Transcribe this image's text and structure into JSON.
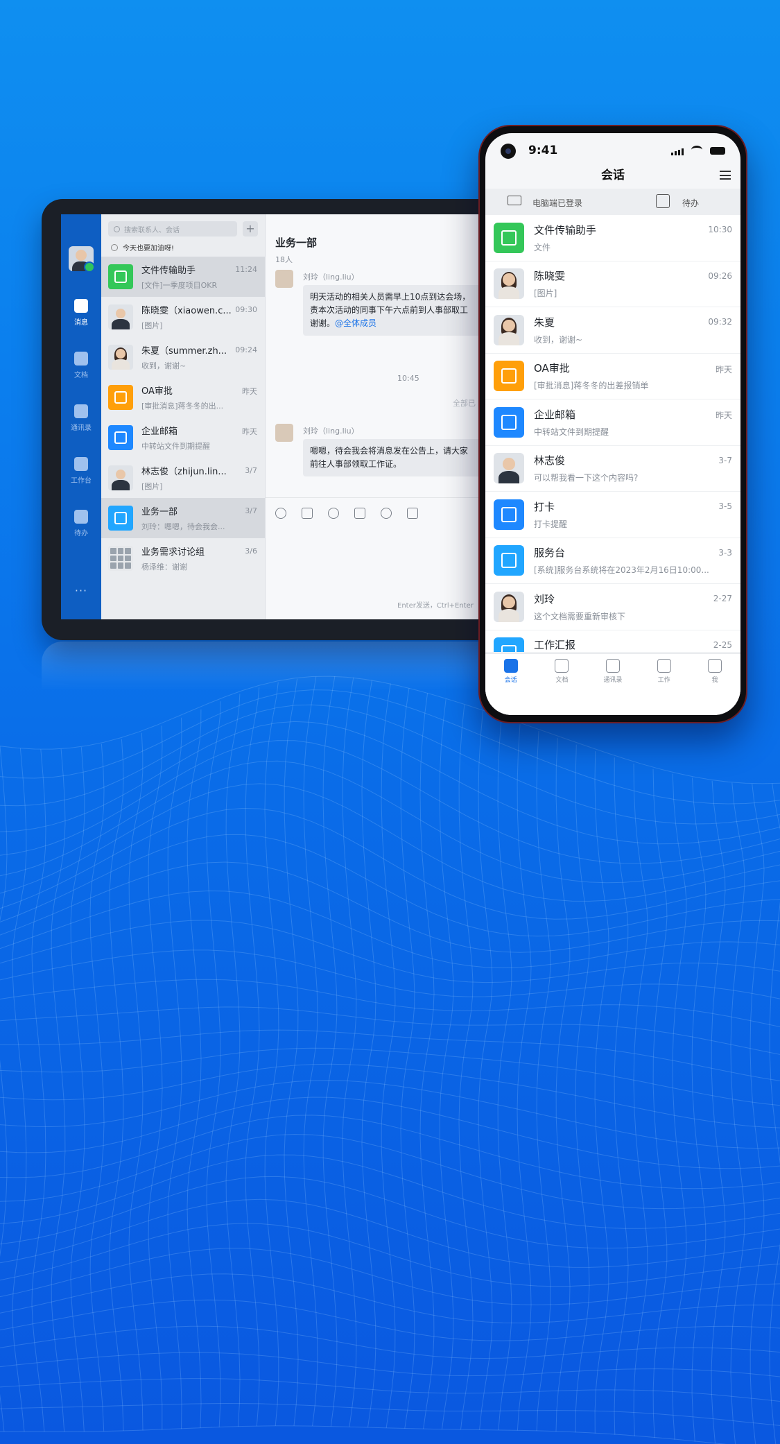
{
  "tablet": {
    "search_placeholder": "搜索联系人、会话",
    "add_label": "+",
    "motto": "今天也要加油呀!",
    "rail": [
      {
        "label": "消息",
        "icon": "message-icon",
        "active": true
      },
      {
        "label": "文档",
        "icon": "document-icon",
        "active": false
      },
      {
        "label": "通讯录",
        "icon": "contacts-icon",
        "active": false
      },
      {
        "label": "工作台",
        "icon": "workbench-icon",
        "active": false
      },
      {
        "label": "待办",
        "icon": "todo-icon",
        "active": false
      }
    ],
    "more_label": "···",
    "conversations": [
      {
        "name": "文件传输助手",
        "preview": "[文件]一季度项目OKR",
        "time": "11:24",
        "avatar": "green",
        "selected": true
      },
      {
        "name": "陈晓雯（xiaowen.c...",
        "preview": "[图片]",
        "time": "09:30",
        "avatar": "photo-m"
      },
      {
        "name": "朱夏（summer.zh...",
        "preview": "收到，谢谢~",
        "time": "09:24",
        "avatar": "photo-f"
      },
      {
        "name": "OA审批",
        "preview": "[审批消息]蒋冬冬的出...",
        "time": "昨天",
        "avatar": "orange"
      },
      {
        "name": "企业邮箱",
        "preview": "中转站文件到期提醒",
        "time": "昨天",
        "avatar": "blue"
      },
      {
        "name": "林志俊（zhijun.lin...",
        "preview": "[图片]",
        "time": "3/7",
        "avatar": "photo-m"
      },
      {
        "name": "业务一部",
        "preview": "刘玲：嗯嗯，待会我会...",
        "time": "3/7",
        "avatar": "cyan",
        "selected": true
      },
      {
        "name": "业务需求讨论组",
        "preview": "杨泽维：谢谢",
        "time": "3/6",
        "avatar": "group"
      }
    ],
    "chat": {
      "title": "业务一部",
      "member_count": "18人",
      "msg1_sender": "刘玲（ling.liu）",
      "msg1_line1": "明天活动的相关人员需早上10点到达会场，",
      "msg1_line2": "责本次活动的同事下午六点前到人事部取工",
      "msg1_line3_prefix": "谢谢。",
      "msg1_mention": "@全体成员",
      "time_divider": "10:45",
      "read_status": "全部已",
      "msg2_sender": "刘玲（ling.liu）",
      "msg2_line1": "嗯嗯，待会我会将消息发在公告上，请大家",
      "msg2_line2": "前往人事部领取工作证。",
      "send_hint": "Enter发送，Ctrl+Enter"
    }
  },
  "phone": {
    "time": "9:41",
    "title": "会话",
    "pc_login": "电脑端已登录",
    "todo": "待办",
    "conversations": [
      {
        "name": "文件传输助手",
        "preview": "文件",
        "time": "10:30",
        "avatar": "green"
      },
      {
        "name": "陈晓雯",
        "preview": "[图片]",
        "time": "09:26",
        "avatar": "photo-f"
      },
      {
        "name": "朱夏",
        "preview": "收到，谢谢~",
        "time": "09:32",
        "avatar": "photo-f"
      },
      {
        "name": "OA审批",
        "preview": "[审批消息]蒋冬冬的出差报销单",
        "time": "昨天",
        "avatar": "orange"
      },
      {
        "name": "企业邮箱",
        "preview": "中转站文件到期提醒",
        "time": "昨天",
        "avatar": "blue"
      },
      {
        "name": "林志俊",
        "preview": "可以帮我看一下这个内容吗?",
        "time": "3-7",
        "avatar": "photo-m"
      },
      {
        "name": "打卡",
        "preview": "打卡提醒",
        "time": "3-5",
        "avatar": "blue"
      },
      {
        "name": "服务台",
        "preview": "[系统]服务台系统将在2023年2月16日10:00...",
        "time": "3-3",
        "avatar": "cyan"
      },
      {
        "name": "刘玲",
        "preview": "这个文档需要重新审核下",
        "time": "2-27",
        "avatar": "photo-f"
      },
      {
        "name": "工作汇报",
        "preview": "",
        "time": "2-25",
        "avatar": "cyan"
      }
    ],
    "tabs": [
      {
        "label": "会话",
        "icon": "chat-icon",
        "active": true
      },
      {
        "label": "文档",
        "icon": "document-icon",
        "active": false
      },
      {
        "label": "通讯录",
        "icon": "contacts-icon",
        "active": false
      },
      {
        "label": "工作",
        "icon": "briefcase-icon",
        "active": false
      },
      {
        "label": "我",
        "icon": "profile-icon",
        "active": false
      }
    ]
  },
  "colors": {
    "background_top": "#0f8ff0",
    "background_bottom": "#0a58e0",
    "rail": "#0e5ec2",
    "accent": "#1a73e8",
    "mention": "#1a73e8"
  }
}
